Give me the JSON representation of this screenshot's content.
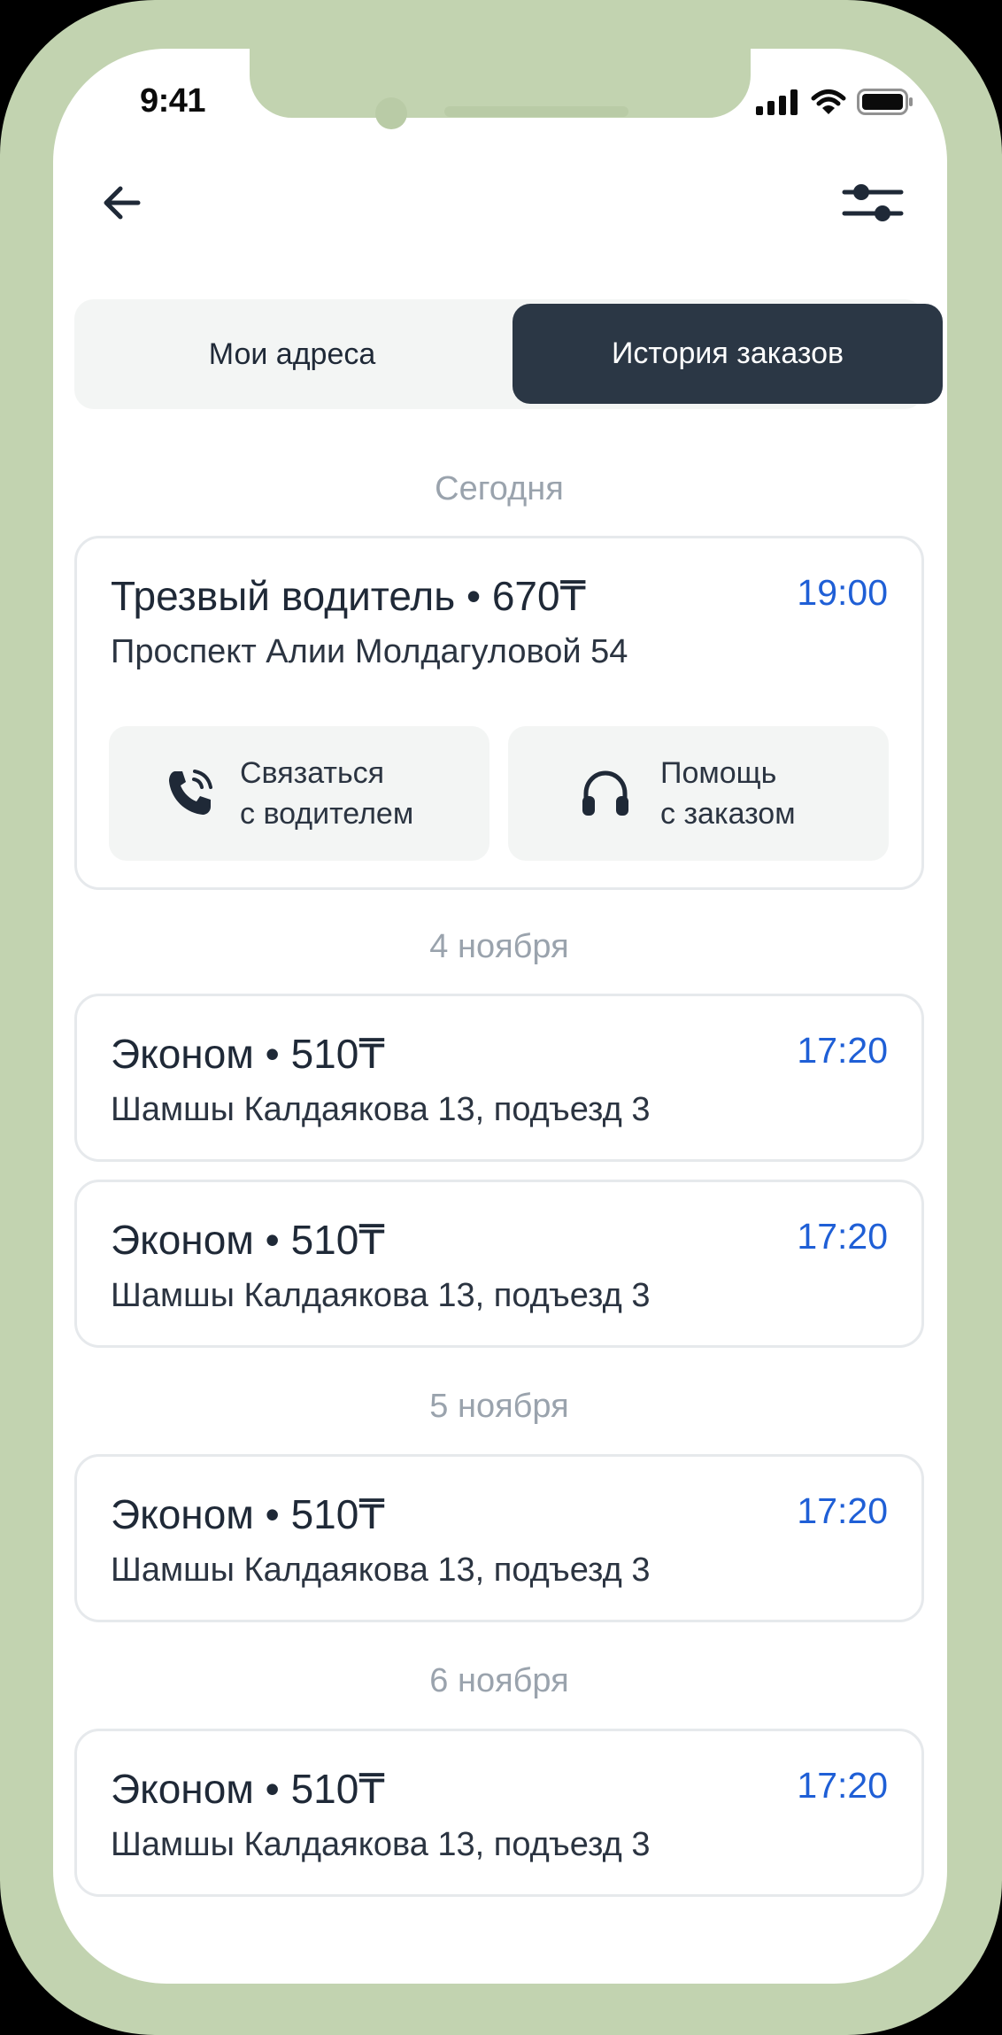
{
  "status": {
    "time": "9:41"
  },
  "tabs": [
    {
      "label": "Мои адреса",
      "active": false
    },
    {
      "label": "История заказов",
      "active": true
    }
  ],
  "icons": {
    "back": "arrow-left-icon",
    "filter": "sliders-icon",
    "call": "phone-icon",
    "help": "headphones-icon"
  },
  "colors": {
    "frame": "#c2d3b0",
    "active_tab": "#2b3745",
    "time_accent": "#1f5fd6",
    "muted": "#9aa3ad"
  },
  "sections": [
    {
      "heading": "Сегодня",
      "orders": [
        {
          "title": "Трезвый водитель • 670₸",
          "time": "19:00",
          "address": "Проспект Алии Молдагуловой 54",
          "actions": [
            {
              "line1": "Связаться",
              "line2": "с водителем"
            },
            {
              "line1": "Помощь",
              "line2": "с заказом"
            }
          ]
        }
      ]
    },
    {
      "heading": "4 ноября",
      "orders": [
        {
          "title": "Эконом • 510₸",
          "time": "17:20",
          "address": "Шамшы Калдаякова 13, подъезд 3"
        },
        {
          "title": "Эконом • 510₸",
          "time": "17:20",
          "address": "Шамшы Калдаякова 13, подъезд 3"
        }
      ]
    },
    {
      "heading": "5 ноября",
      "orders": [
        {
          "title": "Эконом • 510₸",
          "time": "17:20",
          "address": "Шамшы Калдаякова 13, подъезд 3"
        }
      ]
    },
    {
      "heading": "6 ноября",
      "orders": [
        {
          "title": "Эконом • 510₸",
          "time": "17:20",
          "address": "Шамшы Калдаякова 13, подъезд 3"
        }
      ]
    }
  ]
}
